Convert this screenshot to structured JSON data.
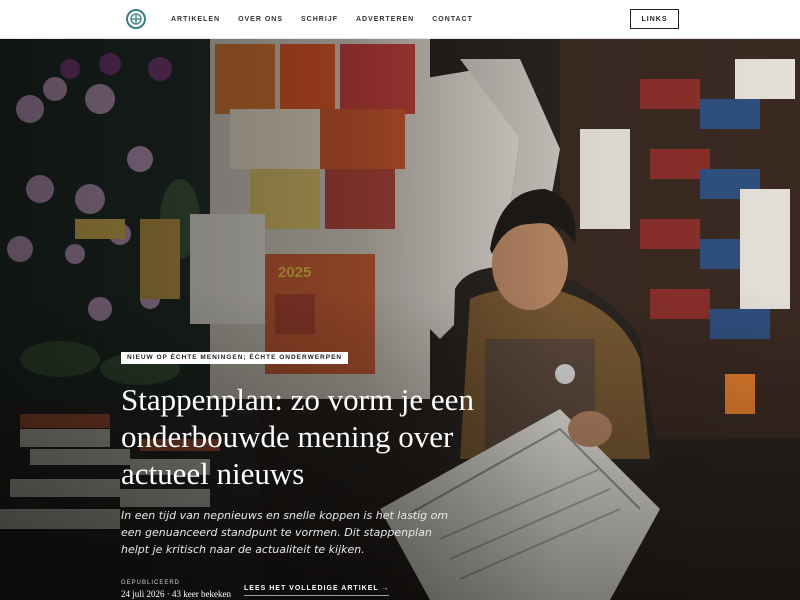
{
  "nav": {
    "items": [
      {
        "label": "ARTIKELEN"
      },
      {
        "label": "OVER ONS"
      },
      {
        "label": "SCHRIJF"
      },
      {
        "label": "ADVERTEREN"
      },
      {
        "label": "CONTACT"
      }
    ],
    "cta_label": "LINKS"
  },
  "hero": {
    "tag": "NIEUW OP ÉCHTE MENINGEN; ÉCHTE ONDERWERPEN",
    "headline": "Stappenplan: zo vorm je een onderbouwde mening over actueel nieuws",
    "lead": "In een tijd van nepnieuws en snelle koppen is het lastig om een genuanceerd standpunt te vormen. Dit stappenplan helpt je kritisch naar de actualiteit te kijken.",
    "published_label": "GEPUBLICEERD",
    "published_value": "24 juli 2026 · 43 keer bekeken",
    "read_more": "LEES HET VOLLEDIGE ARTIKEL →",
    "photo_text": "2025"
  },
  "colors": {
    "logo_accent": "#3a7f86",
    "nav_text": "#333333",
    "hero_text": "#ffffff"
  },
  "icons": {
    "logo": "compass-logo-icon"
  }
}
